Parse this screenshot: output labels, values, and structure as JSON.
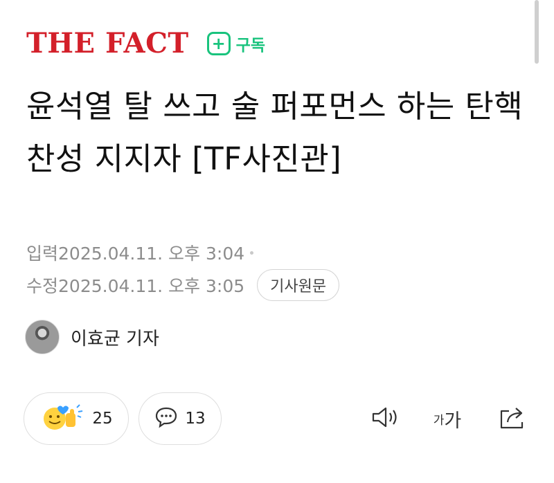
{
  "brand": {
    "logo_text": "THE FACT",
    "logo_color": "#d3202a",
    "subscribe_icon": "plus",
    "subscribe_label": "구독",
    "accent_color": "#19c37d"
  },
  "article": {
    "title": "윤석열 탈 쓰고 술 퍼포먼스 하는 탄핵 찬성 지지자 [TF사진관]",
    "published_label": "입력",
    "published_time": "2025.04.11. 오후 3:04",
    "modified_label": "수정",
    "modified_time": "2025.04.11. 오후 3:05",
    "original_button": "기사원문"
  },
  "reporter": {
    "name": "이효균 기자",
    "avatar_icon": "reporter-photo"
  },
  "actions": {
    "reaction_icon": "smile-thumbs-emoji",
    "reaction_count": "25",
    "comment_icon": "speech-bubble",
    "comment_count": "13",
    "tts_icon": "speaker",
    "font_small": "가",
    "font_big": "가",
    "share_icon": "share"
  }
}
